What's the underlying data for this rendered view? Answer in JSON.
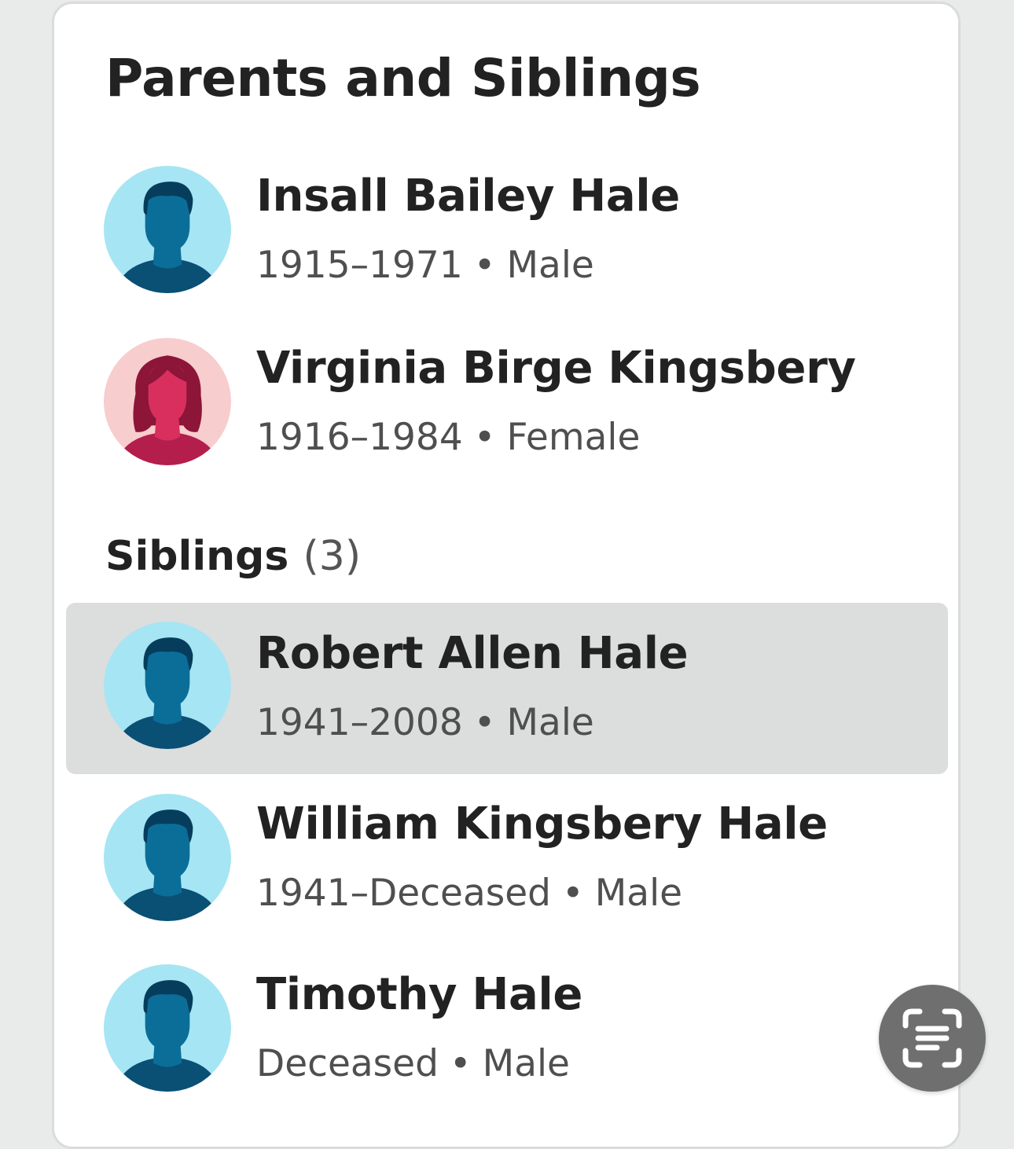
{
  "section": {
    "title": "Parents and Siblings"
  },
  "parents": [
    {
      "name": "Insall Bailey Hale",
      "years": "1915–1971",
      "gender": "Male",
      "avatar_icon": "male-avatar-icon",
      "avatar_bg": "#a6e5f4",
      "avatar_fg": "#0b6e99"
    },
    {
      "name": "Virginia Birge Kingsbery",
      "years": "1916–1984",
      "gender": "Female",
      "avatar_icon": "female-avatar-icon",
      "avatar_bg": "#f8cdcd",
      "avatar_fg": "#d92f5e"
    }
  ],
  "siblings": {
    "label": "Siblings",
    "count": "(3)",
    "items": [
      {
        "name": "Robert Allen Hale",
        "years": "1941–2008",
        "gender": "Male",
        "selected": true,
        "avatar_icon": "male-avatar-icon"
      },
      {
        "name": "William Kingsbery Hale",
        "years": "1941–Deceased",
        "gender": "Male",
        "selected": false,
        "avatar_icon": "male-avatar-icon"
      },
      {
        "name": "Timothy Hale",
        "years": "Deceased",
        "gender": "Male",
        "selected": false,
        "avatar_icon": "male-avatar-icon"
      }
    ]
  },
  "separator": "•",
  "scan_button": {
    "icon": "scan-text-icon",
    "color": "#6f6f6f"
  }
}
